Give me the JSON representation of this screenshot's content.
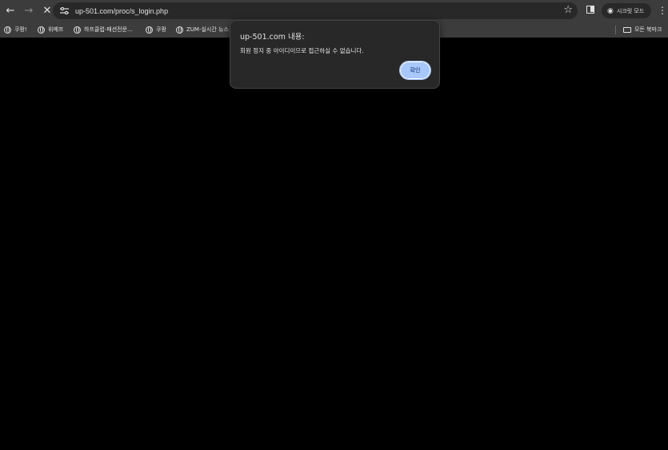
{
  "browser": {
    "url": "up-501.com/proc/s_login.php",
    "incognito_label": "시크릿 모드"
  },
  "bookmarks": {
    "items": [
      {
        "label": "쿠팡!"
      },
      {
        "label": "위메프"
      },
      {
        "label": "하프클럽-패션전문..."
      },
      {
        "label": "쿠팡"
      },
      {
        "label": "ZUM-실시간 뉴스"
      }
    ],
    "all_bookmarks_label": "모든 북마크"
  },
  "dialog": {
    "title": "up-501.com 내용:",
    "message": "회원 정지 중 아이디이므로 접근하실 수 없습니다.",
    "ok_label": "확인"
  }
}
